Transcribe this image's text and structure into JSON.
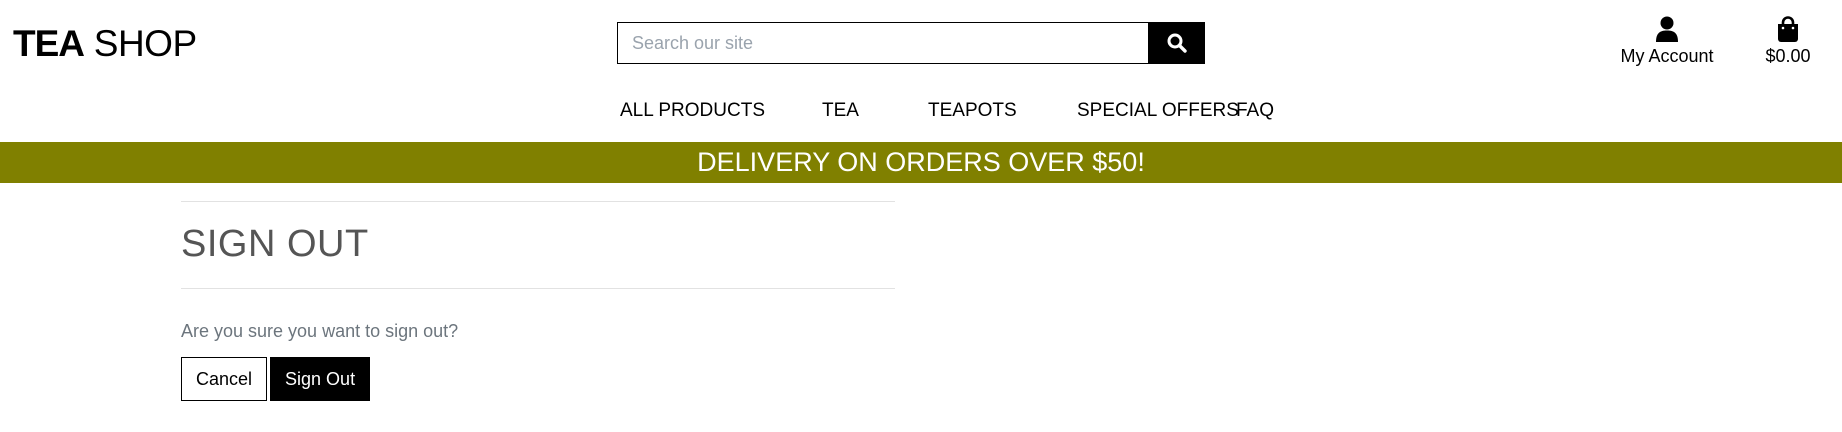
{
  "brand": {
    "part1": "TEA",
    "part2": "SHOP"
  },
  "search": {
    "placeholder": "Search our site",
    "value": "",
    "icon": "search-icon"
  },
  "header": {
    "account_label": "My Account",
    "account_icon": "user-icon",
    "bag_total": "$0.00",
    "bag_icon": "shopping-bag-icon"
  },
  "nav": {
    "items": [
      {
        "label": "ALL PRODUCTS"
      },
      {
        "label": "TEA"
      },
      {
        "label": "TEAPOTS"
      },
      {
        "label": "SPECIAL OFFERS"
      },
      {
        "label": "FAQ"
      }
    ]
  },
  "banner": {
    "text": "DELIVERY ON ORDERS OVER $50!",
    "color": "#808000"
  },
  "main": {
    "title": "SIGN OUT",
    "message": "Are you sure you want to sign out?",
    "cancel_label": "Cancel",
    "signout_label": "Sign Out"
  }
}
